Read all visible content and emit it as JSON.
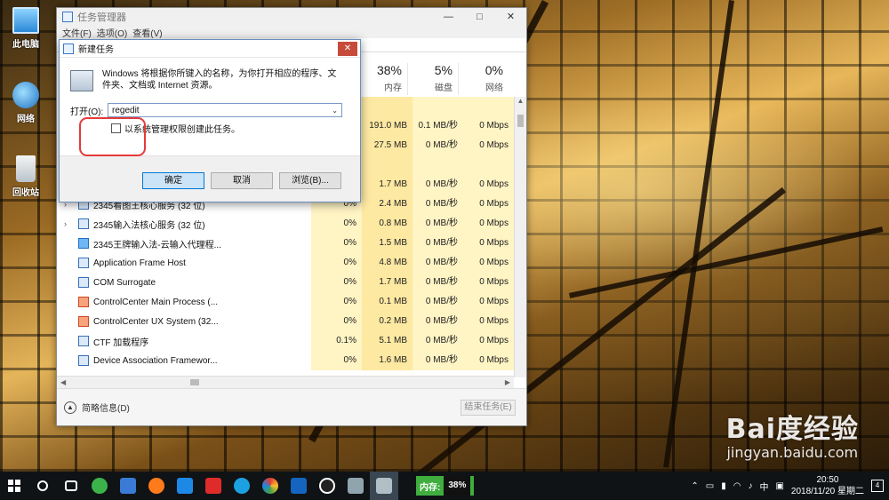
{
  "desktop": {
    "icons": [
      {
        "label": "此电脑"
      },
      {
        "label": "网络"
      },
      {
        "label": "回收站"
      }
    ]
  },
  "task_manager": {
    "title": "任务管理器",
    "menu": [
      "文件(F)",
      "选项(O)",
      "查看(V)"
    ],
    "columns": [
      {
        "pct": "38%",
        "label": "内存"
      },
      {
        "pct": "5%",
        "label": "磁盘"
      },
      {
        "pct": "0%",
        "label": "网络"
      }
    ],
    "rows": [
      {
        "name": "",
        "cpu": "",
        "mem": "",
        "disk": "",
        "net": ""
      },
      {
        "name": "",
        "cpu": "",
        "mem": "191.0 MB",
        "disk": "0.1 MB/秒",
        "net": "0 Mbps"
      },
      {
        "name": "",
        "cpu": "",
        "mem": "27.5 MB",
        "disk": "0 MB/秒",
        "net": "0 Mbps"
      },
      {
        "name": "",
        "cpu": "",
        "mem": "",
        "disk": "",
        "net": ""
      },
      {
        "name": "",
        "cpu": "",
        "mem": "1.7 MB",
        "disk": "0 MB/秒",
        "net": "0 Mbps"
      },
      {
        "name": "2345看图王核心服务 (32 位)",
        "cpu": "0%",
        "mem": "2.4 MB",
        "disk": "0 MB/秒",
        "net": "0 Mbps",
        "expand": true
      },
      {
        "name": "2345输入法核心服务 (32 位)",
        "cpu": "0%",
        "mem": "0.8 MB",
        "disk": "0 MB/秒",
        "net": "0 Mbps",
        "expand": true
      },
      {
        "name": "2345王牌输入法-云输入代理程...",
        "cpu": "0%",
        "mem": "1.5 MB",
        "disk": "0 MB/秒",
        "net": "0 Mbps"
      },
      {
        "name": "Application Frame Host",
        "cpu": "0%",
        "mem": "4.8 MB",
        "disk": "0 MB/秒",
        "net": "0 Mbps"
      },
      {
        "name": "COM Surrogate",
        "cpu": "0%",
        "mem": "1.7 MB",
        "disk": "0 MB/秒",
        "net": "0 Mbps"
      },
      {
        "name": "ControlCenter Main Process (...",
        "cpu": "0%",
        "mem": "0.1 MB",
        "disk": "0 MB/秒",
        "net": "0 Mbps"
      },
      {
        "name": "ControlCenter UX System (32...",
        "cpu": "0%",
        "mem": "0.2 MB",
        "disk": "0 MB/秒",
        "net": "0 Mbps"
      },
      {
        "name": "CTF 加载程序",
        "cpu": "0.1%",
        "mem": "5.1 MB",
        "disk": "0 MB/秒",
        "net": "0 Mbps"
      },
      {
        "name": "Device Association Framewor...",
        "cpu": "0%",
        "mem": "1.6 MB",
        "disk": "0 MB/秒",
        "net": "0 Mbps"
      }
    ],
    "fewer_details": "简略信息(D)",
    "end_task": "结束任务(E)"
  },
  "run_dialog": {
    "title": "新建任务",
    "close": "✕",
    "description": "Windows 将根据你所键入的名称，为你打开相应的程序、文件夹、文档或 Internet 资源。",
    "open_label": "打开(O):",
    "open_value": "regedit",
    "admin_checkbox": "以系统管理权限创建此任务。",
    "ok": "确定",
    "cancel": "取消",
    "browse": "浏览(B)..."
  },
  "watermark": {
    "brand": "Bai度经验",
    "url": "jingyan.baidu.com"
  },
  "taskbar": {
    "memory_label": "内存:",
    "memory_value": "38%",
    "ime": "中",
    "time": "20:50",
    "date": "2018/11/20 星期二",
    "notifications": "4"
  }
}
